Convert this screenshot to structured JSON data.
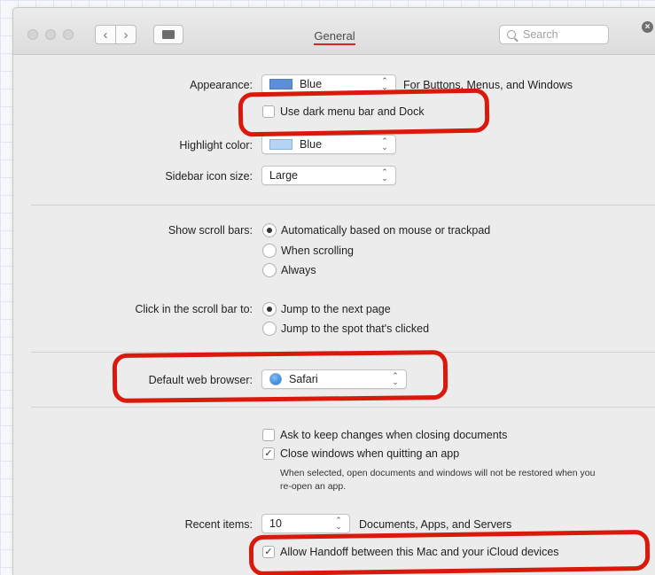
{
  "window": {
    "title": "General"
  },
  "toolbar": {
    "back": "‹",
    "forward": "›",
    "search_placeholder": "Search"
  },
  "appearance": {
    "label": "Appearance:",
    "value": "Blue",
    "trailing": "For Buttons, Menus, and Windows",
    "dark_menu_label": "Use dark menu bar and Dock",
    "dark_menu_checked": false
  },
  "highlight": {
    "label": "Highlight color:",
    "value": "Blue",
    "swatch": "#b6d4f5"
  },
  "sidebar": {
    "label": "Sidebar icon size:",
    "value": "Large"
  },
  "scrollbars": {
    "label": "Show scroll bars:",
    "options": [
      "Automatically based on mouse or trackpad",
      "When scrolling",
      "Always"
    ],
    "selected": 0
  },
  "click_scroll": {
    "label": "Click in the scroll bar to:",
    "options": [
      "Jump to the next page",
      "Jump to the spot that's clicked"
    ],
    "selected": 0
  },
  "browser": {
    "label": "Default web browser:",
    "value": "Safari"
  },
  "documents": {
    "ask_label": "Ask to keep changes when closing documents",
    "ask_checked": false,
    "close_label": "Close windows when quitting an app",
    "close_checked": true,
    "close_note": "When selected, open documents and windows will not be restored when you re-open an app."
  },
  "recent": {
    "label": "Recent items:",
    "value": "10",
    "suffix": "Documents, Apps, and Servers"
  },
  "handoff": {
    "label": "Allow Handoff between this Mac and your iCloud devices",
    "checked": true
  },
  "colors": {
    "annotation": "#d8190c",
    "title_underline": "#cf2a1c"
  },
  "icons": {
    "check": "✓",
    "popup_arrows": "⌃⌄"
  }
}
